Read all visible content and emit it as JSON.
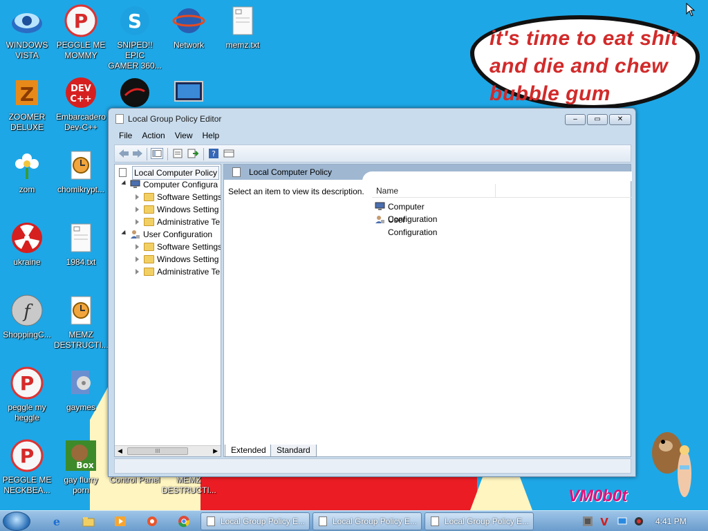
{
  "bubble": {
    "lines": [
      "it's time to eat shit",
      "and die and chew",
      "bubble gum"
    ]
  },
  "brand": "VM0b0t",
  "desktop_icons": [
    {
      "label": "WINDOWS\nVISTA",
      "icon": "vista-icon"
    },
    {
      "label": "PEGGLE ME\nMOMMY",
      "icon": "peggle-icon"
    },
    {
      "label": "SNIPED!! EPIC\nGAMER 360...",
      "icon": "skype-icon"
    },
    {
      "label": "Network",
      "icon": "network-icon"
    },
    {
      "label": "memz.txt",
      "icon": "text-file-icon"
    },
    {
      "label": "ZOOMER\nDELUXE",
      "icon": "zoomer-icon"
    },
    {
      "label": "Embarcadero\nDev-C++",
      "icon": "devcpp-icon"
    },
    {
      "label": "",
      "icon": "dark-app-icon"
    },
    {
      "label": "",
      "icon": "monitor-icon"
    },
    {
      "label": "zom",
      "icon": "flower-icon"
    },
    {
      "label": "chomikrypt...",
      "icon": "clock-app-icon"
    },
    {
      "label": "ukraine",
      "icon": "radiation-icon"
    },
    {
      "label": "1984.txt",
      "icon": "text-file-icon"
    },
    {
      "label": "ShoppingC...",
      "icon": "flash-icon"
    },
    {
      "label": "MEMZ\nDESTRUCTI...",
      "icon": "clock-app-icon"
    },
    {
      "label": "peggle my\nheggle",
      "icon": "peggle-icon"
    },
    {
      "label": "gaymes",
      "icon": "folder-media-icon"
    },
    {
      "label": "PEGGLE ME\nNECKBEA...",
      "icon": "peggle-icon"
    },
    {
      "label": "gay flurry\nporn",
      "icon": "beaver-box-icon"
    },
    {
      "label": "Control Panel",
      "icon": "control-panel-icon"
    },
    {
      "label": "MEMZ\nDESTRUCTI...",
      "icon": "clock-app-icon"
    }
  ],
  "window": {
    "title": "Local Group Policy Editor",
    "menu": [
      "File",
      "Action",
      "View",
      "Help"
    ],
    "tree": [
      {
        "label": "Local Computer Policy",
        "level": 0,
        "expander": "none",
        "icon": "policy-icon",
        "selected": true
      },
      {
        "label": "Computer Configura",
        "level": 1,
        "expander": "open",
        "icon": "computer-config-icon"
      },
      {
        "label": "Software Settings",
        "level": 2,
        "expander": "closed",
        "icon": "folder-icon"
      },
      {
        "label": "Windows Setting",
        "level": 2,
        "expander": "closed",
        "icon": "folder-icon"
      },
      {
        "label": "Administrative Te",
        "level": 2,
        "expander": "closed",
        "icon": "folder-icon"
      },
      {
        "label": "User Configuration",
        "level": 1,
        "expander": "open",
        "icon": "user-config-icon"
      },
      {
        "label": "Software Settings",
        "level": 2,
        "expander": "closed",
        "icon": "folder-icon"
      },
      {
        "label": "Windows Setting",
        "level": 2,
        "expander": "closed",
        "icon": "folder-icon"
      },
      {
        "label": "Administrative Te",
        "level": 2,
        "expander": "closed",
        "icon": "folder-icon"
      }
    ],
    "pane": {
      "header": "Local Computer Policy",
      "description": "Select an item to view its description.",
      "column": "Name",
      "items": [
        "Computer Configuration",
        "User Configuration"
      ]
    },
    "tabs": [
      "Extended",
      "Standard"
    ],
    "scroll_grip": "III"
  },
  "taskbar": {
    "buttons": [
      "Local Group Policy E...",
      "Local Group Policy E...",
      "Local Group Policy E..."
    ],
    "clock": "4:41 PM"
  }
}
